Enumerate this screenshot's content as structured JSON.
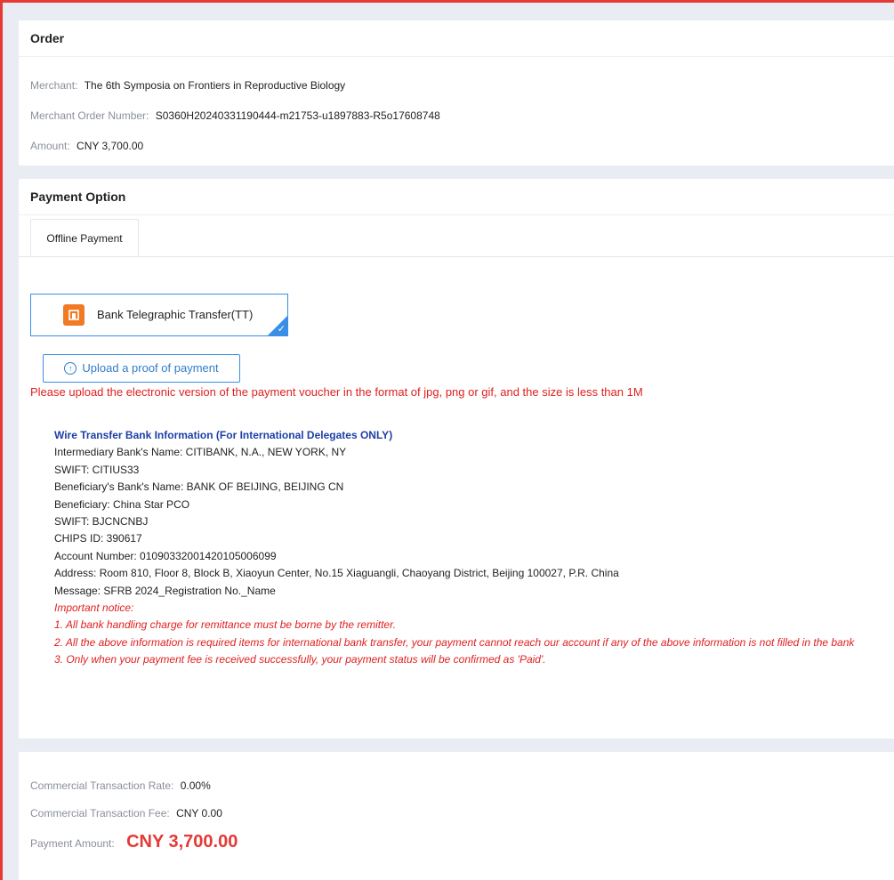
{
  "order": {
    "title": "Order",
    "merchant_label": "Merchant:",
    "merchant_value": "The 6th Symposia on Frontiers in Reproductive Biology",
    "order_number_label": "Merchant Order Number:",
    "order_number_value": "S0360H20240331190444-m21753-u1897883-R5o17608748",
    "amount_label": "Amount:",
    "amount_value": "CNY 3,700.00"
  },
  "payment": {
    "title": "Payment Option",
    "tab_label": "Offline Payment",
    "method_label": "Bank Telegraphic Transfer(TT)",
    "method_icon": "bank-icon",
    "upload_button_label": "Upload a proof of payment",
    "upload_hint": "Please upload the electronic version of the payment voucher in the format of jpg, png or gif, and the size is less than 1M",
    "wire": {
      "title": "Wire Transfer Bank Information (For International Delegates ONLY)",
      "lines": [
        "Intermediary Bank's Name: CITIBANK, N.A., NEW YORK, NY",
        "SWIFT: CITIUS33",
        "Beneficiary's Bank's Name: BANK OF BEIJING, BEIJING CN",
        "Beneficiary: China Star PCO",
        "SWIFT: BJCNCNBJ",
        "CHIPS ID: 390617",
        "Account Number: 01090332001420105006099",
        "Address:  Room 810, Floor 8, Block B, Xiaoyun Center, No.15 Xiaguangli, Chaoyang District, Beijing 100027, P.R. China",
        "Message: SFRB 2024_Registration No._Name"
      ],
      "notice_title": "Important notice:",
      "notices": [
        "1. All bank handling charge for remittance must be borne by the remitter.",
        "2. All the above information is required items for international bank transfer, your payment cannot reach our account if any of the above information is not filled in the bank",
        "3. Only when your payment fee is received successfully, your payment status will be confirmed as 'Paid'."
      ]
    }
  },
  "summary": {
    "rate_label": "Commercial Transaction Rate:",
    "rate_value": "0.00%",
    "fee_label": "Commercial Transaction Fee:",
    "fee_value": "CNY 0.00",
    "payment_amount_label": "Payment Amount:",
    "payment_amount_value": "CNY 3,700.00"
  },
  "colors": {
    "accent_blue": "#3a8ee6",
    "alert_red": "#e02020",
    "frame_red": "#e53935",
    "method_icon_orange": "#f07b24"
  }
}
